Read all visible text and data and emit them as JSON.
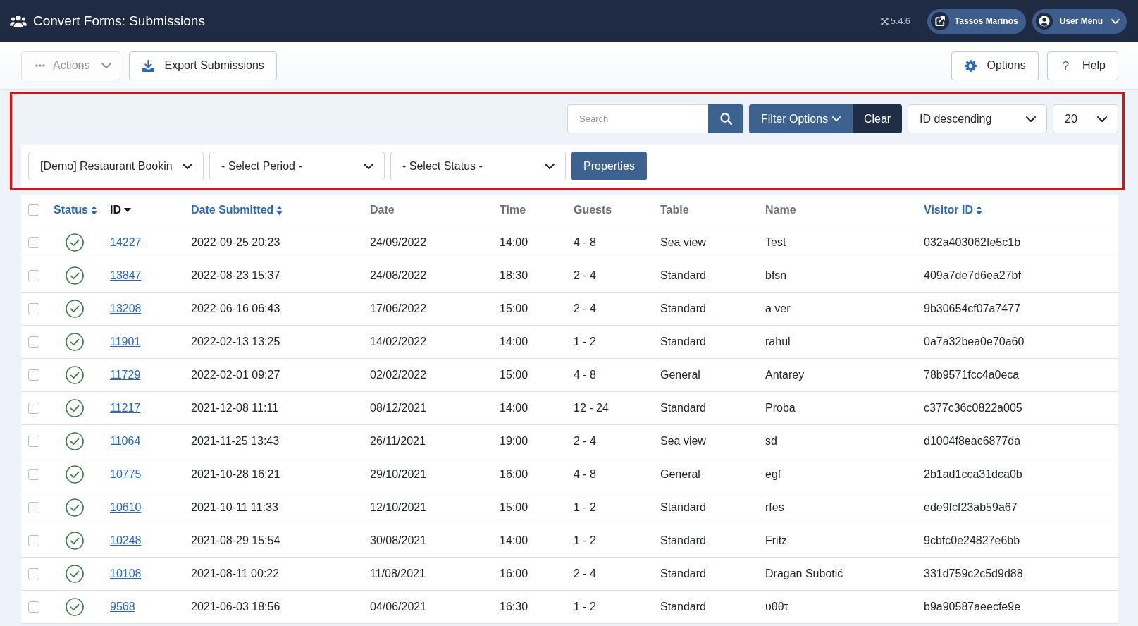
{
  "header": {
    "title": "Convert Forms: Submissions",
    "version": "5.4.6",
    "site_button": "Tassos Marinos",
    "user_menu": "User Menu"
  },
  "toolbar": {
    "left": [
      {
        "kind": "actions",
        "label": "Actions",
        "disabled": true
      },
      {
        "kind": "export",
        "label": "Export Submissions",
        "disabled": false
      }
    ],
    "right": [
      {
        "kind": "options",
        "label": "Options"
      },
      {
        "kind": "help",
        "label": "Help",
        "icon": "?"
      }
    ]
  },
  "filters": {
    "highlighted": true,
    "search": {
      "placeholder": "Search"
    },
    "filter_options": "Filter Options",
    "clear": "Clear",
    "ordering": "ID descending",
    "limit": "20",
    "selects": [
      "[Demo] Restaurant Bookin",
      "- Select Period -",
      "- Select Status -"
    ],
    "properties": "Properties"
  },
  "table": {
    "select_all": {
      "checked": false
    },
    "columns": [
      {
        "label": "Status",
        "kind": "sortable"
      },
      {
        "label": "ID",
        "kind": "sorted"
      },
      {
        "label": "Date Submitted",
        "kind": "sortable"
      },
      {
        "label": "Date",
        "kind": "plain"
      },
      {
        "label": "Time",
        "kind": "plain"
      },
      {
        "label": "Guests",
        "kind": "plain"
      },
      {
        "label": "Table",
        "kind": "plain"
      },
      {
        "label": "Name",
        "kind": "plain"
      },
      {
        "label": "Visitor ID",
        "kind": "sortable"
      }
    ],
    "rows": [
      {
        "checked": false,
        "published": true,
        "id": "14227",
        "date_submitted": "2022-09-25 20:23",
        "date": "24/09/2022",
        "time": "14:00",
        "guests": "4 - 8",
        "table": "Sea view",
        "name": "Test",
        "visitor_id": "032a403062fe5c1b"
      },
      {
        "checked": false,
        "published": true,
        "id": "13847",
        "date_submitted": "2022-08-23 15:37",
        "date": "24/08/2022",
        "time": "18:30",
        "guests": "2 - 4",
        "table": "Standard",
        "name": "bfsn",
        "visitor_id": "409a7de7d6ea27bf"
      },
      {
        "checked": false,
        "published": true,
        "id": "13208",
        "date_submitted": "2022-06-16 06:43",
        "date": "17/06/2022",
        "time": "15:00",
        "guests": "2 - 4",
        "table": "Standard",
        "name": "a ver",
        "visitor_id": "9b30654cf07a7477"
      },
      {
        "checked": false,
        "published": true,
        "id": "11901",
        "date_submitted": "2022-02-13 13:25",
        "date": "14/02/2022",
        "time": "14:00",
        "guests": "1 - 2",
        "table": "Standard",
        "name": "rahul",
        "visitor_id": "0a7a32bea0e70a60"
      },
      {
        "checked": false,
        "published": true,
        "id": "11729",
        "date_submitted": "2022-02-01 09:27",
        "date": "02/02/2022",
        "time": "15:00",
        "guests": "4 - 8",
        "table": "General",
        "name": "Antarey",
        "visitor_id": "78b9571fcc4a0eca"
      },
      {
        "checked": false,
        "published": true,
        "id": "11217",
        "date_submitted": "2021-12-08 11:11",
        "date": "08/12/2021",
        "time": "14:00",
        "guests": "12 - 24",
        "table": "Standard",
        "name": "Proba",
        "visitor_id": "c377c36c0822a005"
      },
      {
        "checked": false,
        "published": true,
        "id": "11064",
        "date_submitted": "2021-11-25 13:43",
        "date": "26/11/2021",
        "time": "19:00",
        "guests": "2 - 4",
        "table": "Sea view",
        "name": "sd",
        "visitor_id": "d1004f8eac6877da"
      },
      {
        "checked": false,
        "published": true,
        "id": "10775",
        "date_submitted": "2021-10-28 16:21",
        "date": "29/10/2021",
        "time": "16:00",
        "guests": "4 - 8",
        "table": "General",
        "name": "egf",
        "visitor_id": "2b1ad1cca31dca0b"
      },
      {
        "checked": false,
        "published": true,
        "id": "10610",
        "date_submitted": "2021-10-11 11:33",
        "date": "12/10/2021",
        "time": "15:00",
        "guests": "1 - 2",
        "table": "Standard",
        "name": "rfes",
        "visitor_id": "ede9fcf23ab59a67"
      },
      {
        "checked": false,
        "published": true,
        "id": "10248",
        "date_submitted": "2021-08-29 15:54",
        "date": "30/08/2021",
        "time": "14:00",
        "guests": "1 - 2",
        "table": "Standard",
        "name": "Fritz",
        "visitor_id": "9cbfc0e24827e6bb"
      },
      {
        "checked": false,
        "published": true,
        "id": "10108",
        "date_submitted": "2021-08-11 00:22",
        "date": "11/08/2021",
        "time": "16:00",
        "guests": "2 - 4",
        "table": "Standard",
        "name": "Dragan Subotić",
        "visitor_id": "331d759c2c5d9d88"
      },
      {
        "checked": false,
        "published": true,
        "id": "9568",
        "date_submitted": "2021-06-03 18:56",
        "date": "04/06/2021",
        "time": "16:30",
        "guests": "1 - 2",
        "table": "Standard",
        "name": "υθθτ",
        "visitor_id": "b9a90587aeecfe9e"
      }
    ]
  }
}
